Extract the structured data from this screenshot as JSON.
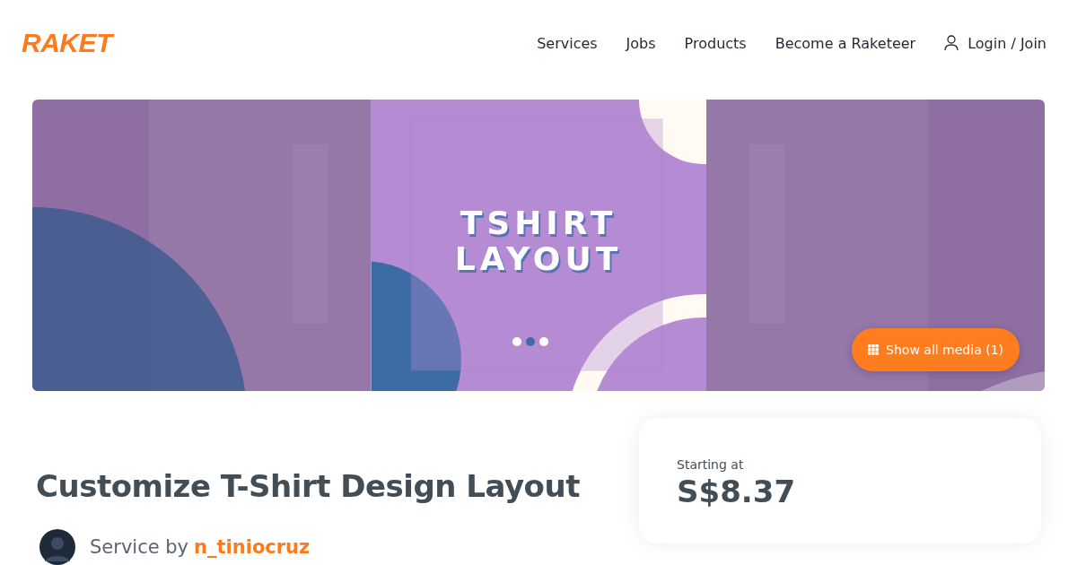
{
  "header": {
    "logo": "RAKET",
    "nav": [
      "Services",
      "Jobs",
      "Products",
      "Become a Raketeer"
    ],
    "login": "Login / Join"
  },
  "media": {
    "image_text": [
      "TSHIRT",
      "LAYOUT"
    ],
    "button": "Show all media (1)"
  },
  "service": {
    "title": "Customize T-Shirt Design Layout",
    "by": "Service by",
    "seller": "n_tiniocruz"
  },
  "price_card": {
    "label": "Starting at",
    "price": "S$8.37"
  }
}
